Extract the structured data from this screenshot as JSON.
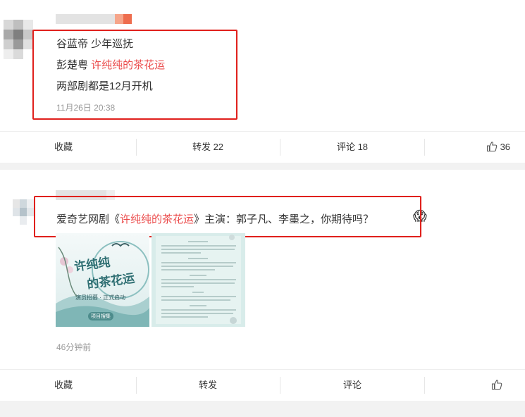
{
  "post1": {
    "lines": [
      "谷蓝帝 少年巡抚",
      "彭楚粤 ",
      "许纯纯的茶花运",
      "两部剧都是12月开机"
    ],
    "time": "11月26日 20:38",
    "actions": {
      "collect": "收藏",
      "forward": "转发 22",
      "comment": "评论 18",
      "like_count": "36"
    }
  },
  "post2": {
    "text_prefix": "爱奇艺网剧《",
    "text_highlight": "许纯纯的茶花运",
    "text_suffix": "》主演：郭子凡、李墨之，你期待吗？",
    "emoji": "😱",
    "poster": {
      "title_line1": "许纯纯",
      "title_line2": "的茶花运",
      "subtitle": "演员招募 · 正式启动",
      "badge": "项目搜集"
    },
    "time": "46分钟前",
    "actions": {
      "collect": "收藏",
      "forward": "转发",
      "comment": "评论"
    }
  },
  "colors": {
    "accent_red": "#eb4b4b",
    "box_red": "#e0201c",
    "time_gray": "#999999"
  }
}
